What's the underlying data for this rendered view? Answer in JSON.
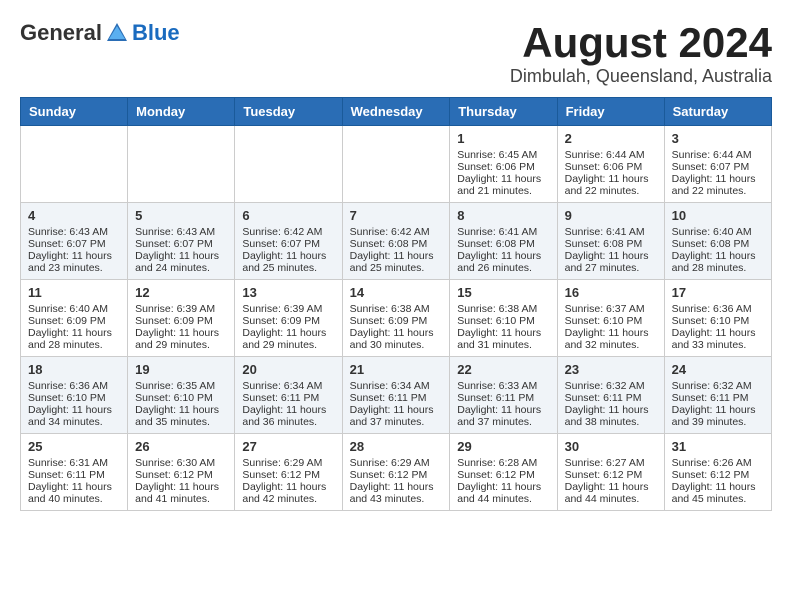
{
  "logo": {
    "general": "General",
    "blue": "Blue"
  },
  "title": {
    "month_year": "August 2024",
    "location": "Dimbulah, Queensland, Australia"
  },
  "headers": [
    "Sunday",
    "Monday",
    "Tuesday",
    "Wednesday",
    "Thursday",
    "Friday",
    "Saturday"
  ],
  "weeks": [
    [
      {
        "day": "",
        "lines": []
      },
      {
        "day": "",
        "lines": []
      },
      {
        "day": "",
        "lines": []
      },
      {
        "day": "",
        "lines": []
      },
      {
        "day": "1",
        "lines": [
          "Sunrise: 6:45 AM",
          "Sunset: 6:06 PM",
          "Daylight: 11 hours",
          "and 21 minutes."
        ]
      },
      {
        "day": "2",
        "lines": [
          "Sunrise: 6:44 AM",
          "Sunset: 6:06 PM",
          "Daylight: 11 hours",
          "and 22 minutes."
        ]
      },
      {
        "day": "3",
        "lines": [
          "Sunrise: 6:44 AM",
          "Sunset: 6:07 PM",
          "Daylight: 11 hours",
          "and 22 minutes."
        ]
      }
    ],
    [
      {
        "day": "4",
        "lines": [
          "Sunrise: 6:43 AM",
          "Sunset: 6:07 PM",
          "Daylight: 11 hours",
          "and 23 minutes."
        ]
      },
      {
        "day": "5",
        "lines": [
          "Sunrise: 6:43 AM",
          "Sunset: 6:07 PM",
          "Daylight: 11 hours",
          "and 24 minutes."
        ]
      },
      {
        "day": "6",
        "lines": [
          "Sunrise: 6:42 AM",
          "Sunset: 6:07 PM",
          "Daylight: 11 hours",
          "and 25 minutes."
        ]
      },
      {
        "day": "7",
        "lines": [
          "Sunrise: 6:42 AM",
          "Sunset: 6:08 PM",
          "Daylight: 11 hours",
          "and 25 minutes."
        ]
      },
      {
        "day": "8",
        "lines": [
          "Sunrise: 6:41 AM",
          "Sunset: 6:08 PM",
          "Daylight: 11 hours",
          "and 26 minutes."
        ]
      },
      {
        "day": "9",
        "lines": [
          "Sunrise: 6:41 AM",
          "Sunset: 6:08 PM",
          "Daylight: 11 hours",
          "and 27 minutes."
        ]
      },
      {
        "day": "10",
        "lines": [
          "Sunrise: 6:40 AM",
          "Sunset: 6:08 PM",
          "Daylight: 11 hours",
          "and 28 minutes."
        ]
      }
    ],
    [
      {
        "day": "11",
        "lines": [
          "Sunrise: 6:40 AM",
          "Sunset: 6:09 PM",
          "Daylight: 11 hours",
          "and 28 minutes."
        ]
      },
      {
        "day": "12",
        "lines": [
          "Sunrise: 6:39 AM",
          "Sunset: 6:09 PM",
          "Daylight: 11 hours",
          "and 29 minutes."
        ]
      },
      {
        "day": "13",
        "lines": [
          "Sunrise: 6:39 AM",
          "Sunset: 6:09 PM",
          "Daylight: 11 hours",
          "and 29 minutes."
        ]
      },
      {
        "day": "14",
        "lines": [
          "Sunrise: 6:38 AM",
          "Sunset: 6:09 PM",
          "Daylight: 11 hours",
          "and 30 minutes."
        ]
      },
      {
        "day": "15",
        "lines": [
          "Sunrise: 6:38 AM",
          "Sunset: 6:10 PM",
          "Daylight: 11 hours",
          "and 31 minutes."
        ]
      },
      {
        "day": "16",
        "lines": [
          "Sunrise: 6:37 AM",
          "Sunset: 6:10 PM",
          "Daylight: 11 hours",
          "and 32 minutes."
        ]
      },
      {
        "day": "17",
        "lines": [
          "Sunrise: 6:36 AM",
          "Sunset: 6:10 PM",
          "Daylight: 11 hours",
          "and 33 minutes."
        ]
      }
    ],
    [
      {
        "day": "18",
        "lines": [
          "Sunrise: 6:36 AM",
          "Sunset: 6:10 PM",
          "Daylight: 11 hours",
          "and 34 minutes."
        ]
      },
      {
        "day": "19",
        "lines": [
          "Sunrise: 6:35 AM",
          "Sunset: 6:10 PM",
          "Daylight: 11 hours",
          "and 35 minutes."
        ]
      },
      {
        "day": "20",
        "lines": [
          "Sunrise: 6:34 AM",
          "Sunset: 6:11 PM",
          "Daylight: 11 hours",
          "and 36 minutes."
        ]
      },
      {
        "day": "21",
        "lines": [
          "Sunrise: 6:34 AM",
          "Sunset: 6:11 PM",
          "Daylight: 11 hours",
          "and 37 minutes."
        ]
      },
      {
        "day": "22",
        "lines": [
          "Sunrise: 6:33 AM",
          "Sunset: 6:11 PM",
          "Daylight: 11 hours",
          "and 37 minutes."
        ]
      },
      {
        "day": "23",
        "lines": [
          "Sunrise: 6:32 AM",
          "Sunset: 6:11 PM",
          "Daylight: 11 hours",
          "and 38 minutes."
        ]
      },
      {
        "day": "24",
        "lines": [
          "Sunrise: 6:32 AM",
          "Sunset: 6:11 PM",
          "Daylight: 11 hours",
          "and 39 minutes."
        ]
      }
    ],
    [
      {
        "day": "25",
        "lines": [
          "Sunrise: 6:31 AM",
          "Sunset: 6:11 PM",
          "Daylight: 11 hours",
          "and 40 minutes."
        ]
      },
      {
        "day": "26",
        "lines": [
          "Sunrise: 6:30 AM",
          "Sunset: 6:12 PM",
          "Daylight: 11 hours",
          "and 41 minutes."
        ]
      },
      {
        "day": "27",
        "lines": [
          "Sunrise: 6:29 AM",
          "Sunset: 6:12 PM",
          "Daylight: 11 hours",
          "and 42 minutes."
        ]
      },
      {
        "day": "28",
        "lines": [
          "Sunrise: 6:29 AM",
          "Sunset: 6:12 PM",
          "Daylight: 11 hours",
          "and 43 minutes."
        ]
      },
      {
        "day": "29",
        "lines": [
          "Sunrise: 6:28 AM",
          "Sunset: 6:12 PM",
          "Daylight: 11 hours",
          "and 44 minutes."
        ]
      },
      {
        "day": "30",
        "lines": [
          "Sunrise: 6:27 AM",
          "Sunset: 6:12 PM",
          "Daylight: 11 hours",
          "and 44 minutes."
        ]
      },
      {
        "day": "31",
        "lines": [
          "Sunrise: 6:26 AM",
          "Sunset: 6:12 PM",
          "Daylight: 11 hours",
          "and 45 minutes."
        ]
      }
    ]
  ]
}
